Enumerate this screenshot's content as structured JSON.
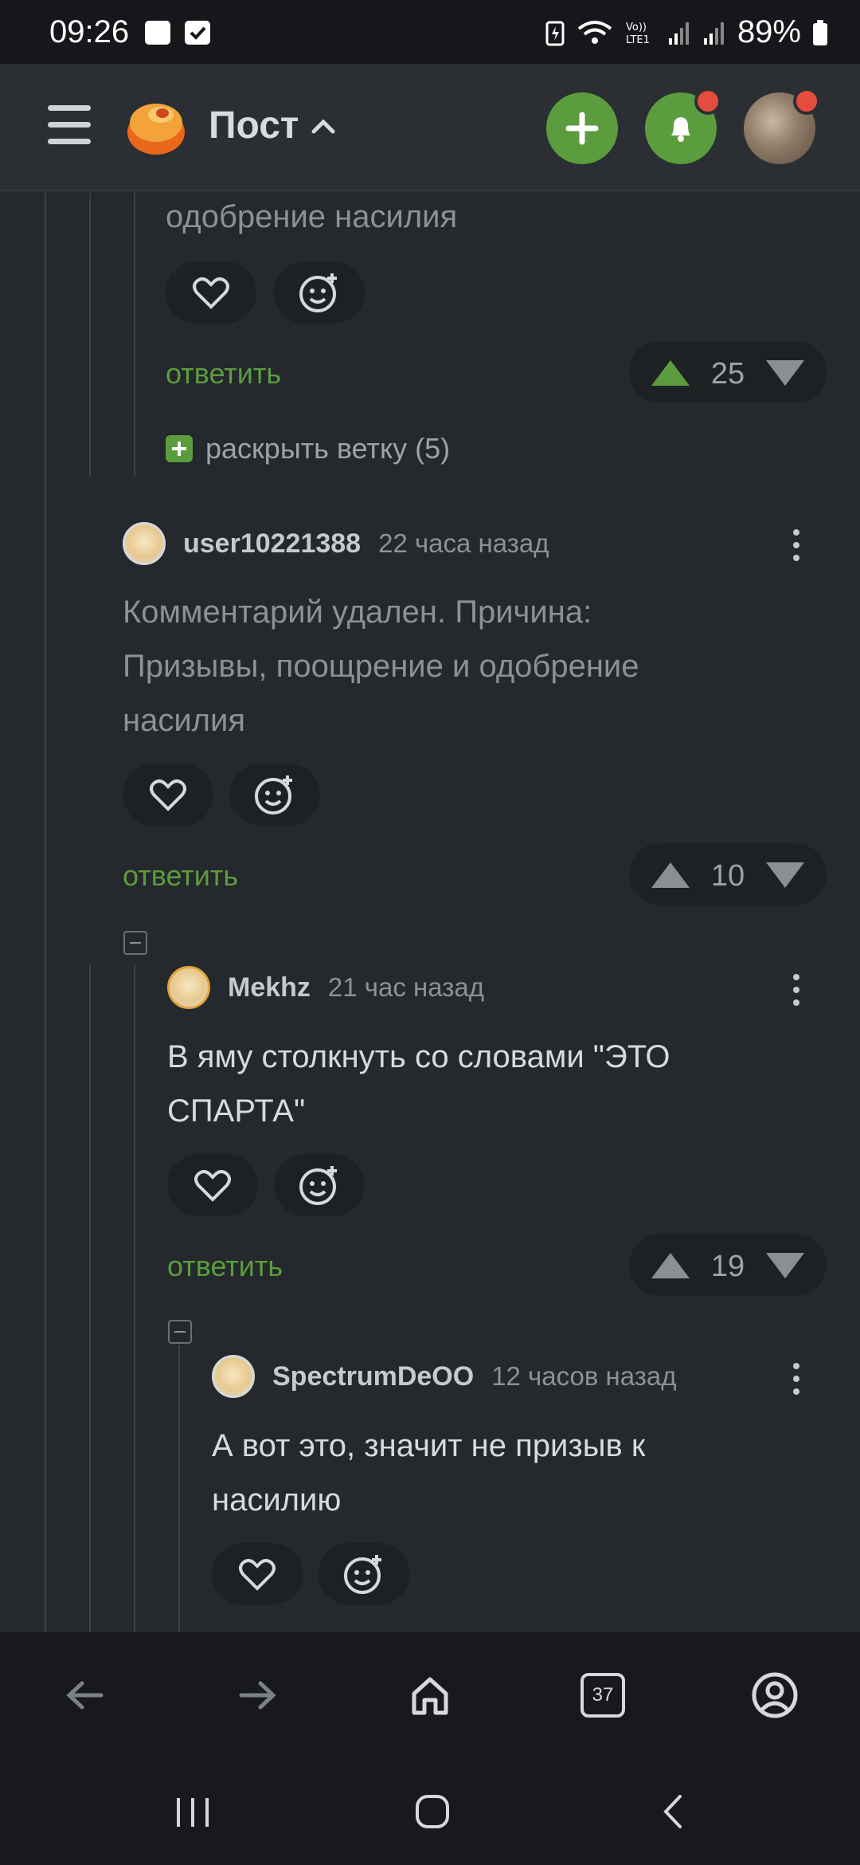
{
  "status_bar": {
    "time": "09:26",
    "battery": "89%"
  },
  "app_bar": {
    "title": "Пост"
  },
  "comments": [
    {
      "text": "одобрение насилия",
      "reply_label": "ответить",
      "score": "25",
      "expand_label": "раскрыть ветку (5)"
    },
    {
      "user": "user10221388",
      "time": "22 часа назад",
      "text": "Комментарий удален. Причина: Призывы, поощрение и одобрение насилия",
      "reply_label": "ответить",
      "score": "10"
    },
    {
      "user": "Mekhz",
      "time": "21 час назад",
      "text": "В яму столкнуть со словами \"ЭТО СПАРТА\"",
      "reply_label": "ответить",
      "score": "19"
    },
    {
      "user": "SpectrumDeOO",
      "time": "12 часов назад",
      "text": "А вот это, значит не призыв к насилию"
    }
  ],
  "bottom_nav": {
    "tabs_count": "37"
  },
  "icons": {
    "menu": "hamburger-icon",
    "logo": "pikabu-logo",
    "add": "plus-icon",
    "notifications": "bell-icon",
    "like": "heart-icon",
    "react": "emoji-add-icon",
    "upvote": "triangle-up-icon",
    "downvote": "triangle-down-icon",
    "back": "arrow-left-icon",
    "forward": "arrow-right-icon",
    "home": "home-icon",
    "account": "user-circle-icon"
  },
  "colors": {
    "accent": "#5b9d3e",
    "background": "#25282c",
    "badge": "#e44c3e"
  }
}
